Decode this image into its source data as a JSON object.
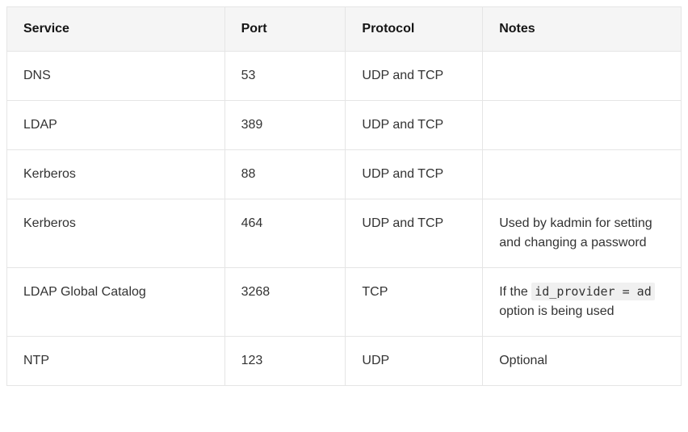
{
  "table": {
    "headers": [
      "Service",
      "Port",
      "Protocol",
      "Notes"
    ],
    "rows": [
      {
        "service": "DNS",
        "port": "53",
        "protocol": "UDP and TCP",
        "notes": ""
      },
      {
        "service": "LDAP",
        "port": "389",
        "protocol": "UDP and TCP",
        "notes": ""
      },
      {
        "service": "Kerberos",
        "port": "88",
        "protocol": "UDP and TCP",
        "notes": ""
      },
      {
        "service": "Kerberos",
        "port": "464",
        "protocol": "UDP and TCP",
        "notes": "Used by kadmin for setting and changing a password"
      },
      {
        "service": "LDAP Global Catalog",
        "port": "3268",
        "protocol": "TCP",
        "notes_parts": {
          "prefix": "If the ",
          "code": "id_provider = ad",
          "suffix": " option is being used"
        }
      },
      {
        "service": "NTP",
        "port": "123",
        "protocol": "UDP",
        "notes": "Optional"
      }
    ]
  }
}
